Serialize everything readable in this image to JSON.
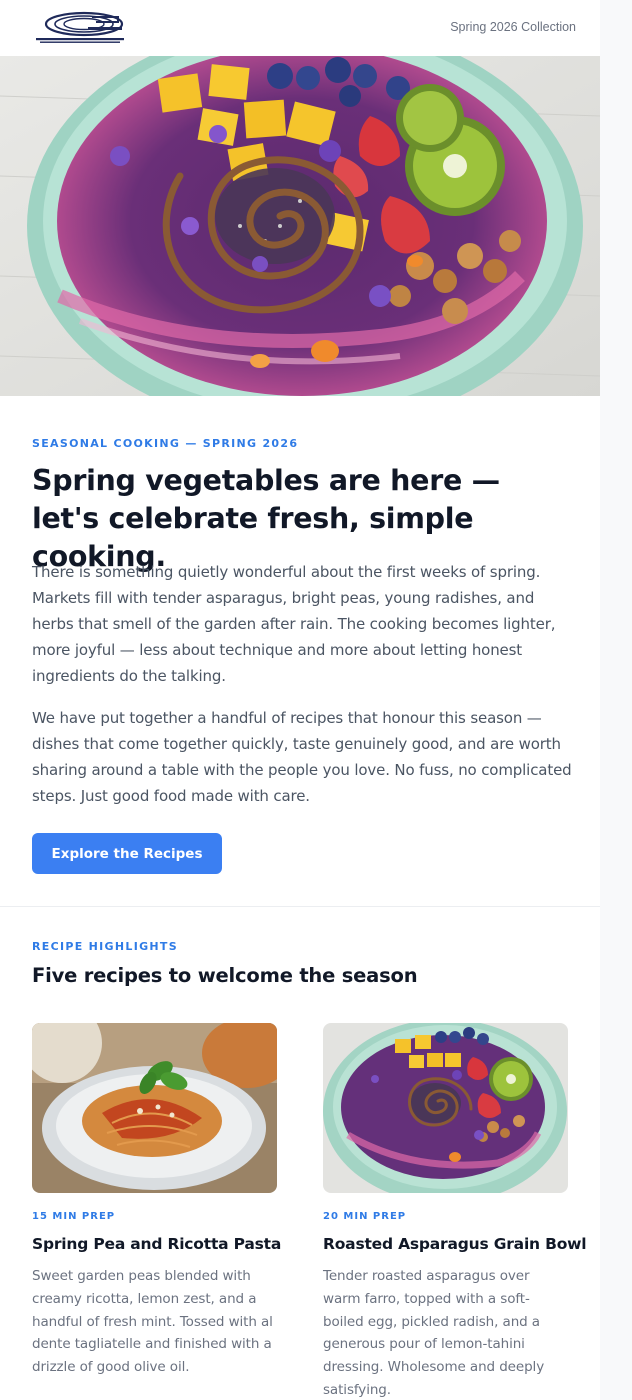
{
  "header": {
    "collection_label": "Spring 2026 Collection"
  },
  "hero": {
    "image_icon": "acai-bowl-image"
  },
  "intro": {
    "eyebrow": "SEASONAL COOKING — SPRING 2026",
    "headline": "Spring vegetables are here — let's celebrate fresh, simple cooking.",
    "paragraph_1": "There is something quietly wonderful about the first weeks of spring. Markets fill with tender asparagus, bright peas, young radishes, and herbs that smell of the garden after rain. The cooking becomes lighter, more joyful — less about technique and more about letting honest ingredients do the talking.",
    "paragraph_2": "We have put together a handful of recipes that honour this season — dishes that come together quickly, taste genuinely good, and are worth sharing around a table with the people you love. No fuss, no complicated steps. Just good food made with care.",
    "cta_label": "Explore the Recipes"
  },
  "highlights": {
    "eyebrow": "RECIPE HIGHLIGHTS",
    "title": "Five recipes to welcome the season",
    "cards": [
      {
        "prep": "15 MIN PREP",
        "title": "Spring Pea and Ricotta Pasta",
        "description": "Sweet garden peas blended with creamy ricotta, lemon zest, and a handful of fresh mint. Tossed with al dente tagliatelle and finished with a drizzle of good olive oil.",
        "image_icon": "pasta-image"
      },
      {
        "prep": "20 MIN PREP",
        "title": "Roasted Asparagus Grain Bowl",
        "description": "Tender roasted asparagus over warm farro, topped with a soft-boiled egg, pickled radish, and a generous pour of lemon-tahini dressing. Wholesome and deeply satisfying.",
        "image_icon": "grain-bowl-image"
      }
    ]
  },
  "colors": {
    "accent": "#2f7be6",
    "button": "#3b7ff2",
    "heading": "#111827",
    "body_text": "#4b5563"
  }
}
